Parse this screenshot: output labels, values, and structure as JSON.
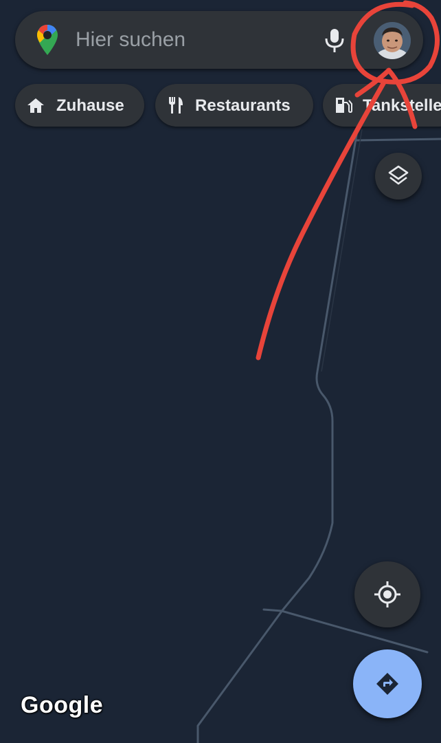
{
  "search": {
    "placeholder": "Hier suchen"
  },
  "chips": [
    {
      "label": "Zuhause",
      "icon": "home-icon"
    },
    {
      "label": "Restaurants",
      "icon": "restaurant-icon"
    },
    {
      "label": "Tankstellen",
      "icon": "gas-station-icon"
    }
  ],
  "map": {
    "watermark": "Google"
  },
  "colors": {
    "map_background": "#1b2535",
    "road": "#4a5a6e",
    "surface": "#2f3338",
    "directions_fab": "#8ab4f8",
    "annotation": "#e8443a"
  }
}
